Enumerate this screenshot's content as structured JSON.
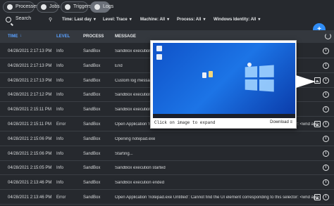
{
  "tabs": [
    {
      "label": "Processes",
      "icon": "gear-icon"
    },
    {
      "label": "Jobs",
      "icon": "jobs-icon"
    },
    {
      "label": "Triggers",
      "icon": "clock-icon"
    },
    {
      "label": "Logs",
      "icon": "logs-icon"
    }
  ],
  "filters": {
    "search_label": "Search",
    "time": "Time: Last day",
    "level": "Level: Trace",
    "machine": "Machine: All",
    "process": "Process: All",
    "identity": "Windows Identity: All"
  },
  "columns": {
    "time": "TIME",
    "level": "LEVEL",
    "process": "PROCESS",
    "message": "MESSAGE"
  },
  "fab_label": "+",
  "rows": [
    {
      "time": "04/28/2021 2:17:13 PM",
      "level": "Info",
      "process": "SandBox",
      "message": "SandBox execution ended"
    },
    {
      "time": "04/28/2021 2:17:13 PM",
      "level": "Info",
      "process": "SandBox",
      "message": "End"
    },
    {
      "time": "04/28/2021 2:17:13 PM",
      "level": "Info",
      "process": "SandBox",
      "message": "Custom log message"
    },
    {
      "time": "04/28/2021 2:17:12 PM",
      "level": "Info",
      "process": "SandBox",
      "message": "SandBox execution started"
    },
    {
      "time": "04/28/2021 2:15:11 PM",
      "level": "Info",
      "process": "SandBox",
      "message": "SandBox execution ended"
    },
    {
      "time": "04/28/2021 2:15:11 PM",
      "level": "Error",
      "process": "SandBox",
      "message": "Open Application 'notepad.exe Untitled': Cannot find the UI element corresponding to this selector: <wnd app='notepad.e"
    },
    {
      "time": "04/28/2021 2:15:06 PM",
      "level": "Info",
      "process": "SandBox",
      "message": "Opening notepad.exe"
    },
    {
      "time": "04/28/2021 2:15:06 PM",
      "level": "Info",
      "process": "SandBox",
      "message": "Starting..."
    },
    {
      "time": "04/28/2021 2:15:05 PM",
      "level": "Info",
      "process": "SandBox",
      "message": "SandBox execution started"
    },
    {
      "time": "04/28/2021 2:13:46 PM",
      "level": "Info",
      "process": "SandBox",
      "message": "SandBox execution ended"
    },
    {
      "time": "04/28/2021 2:13:46 PM",
      "level": "Error",
      "process": "SandBox",
      "message": "Open Application 'notepad.exe Untitled': Cannot find the UI element corresponding to this selector: <wnd app='notepad.exe"
    }
  ],
  "popup": {
    "caption": "Click on image to expand",
    "download": "Download"
  },
  "colors": {
    "accent": "#2f8cf5",
    "background": "#26292e"
  }
}
